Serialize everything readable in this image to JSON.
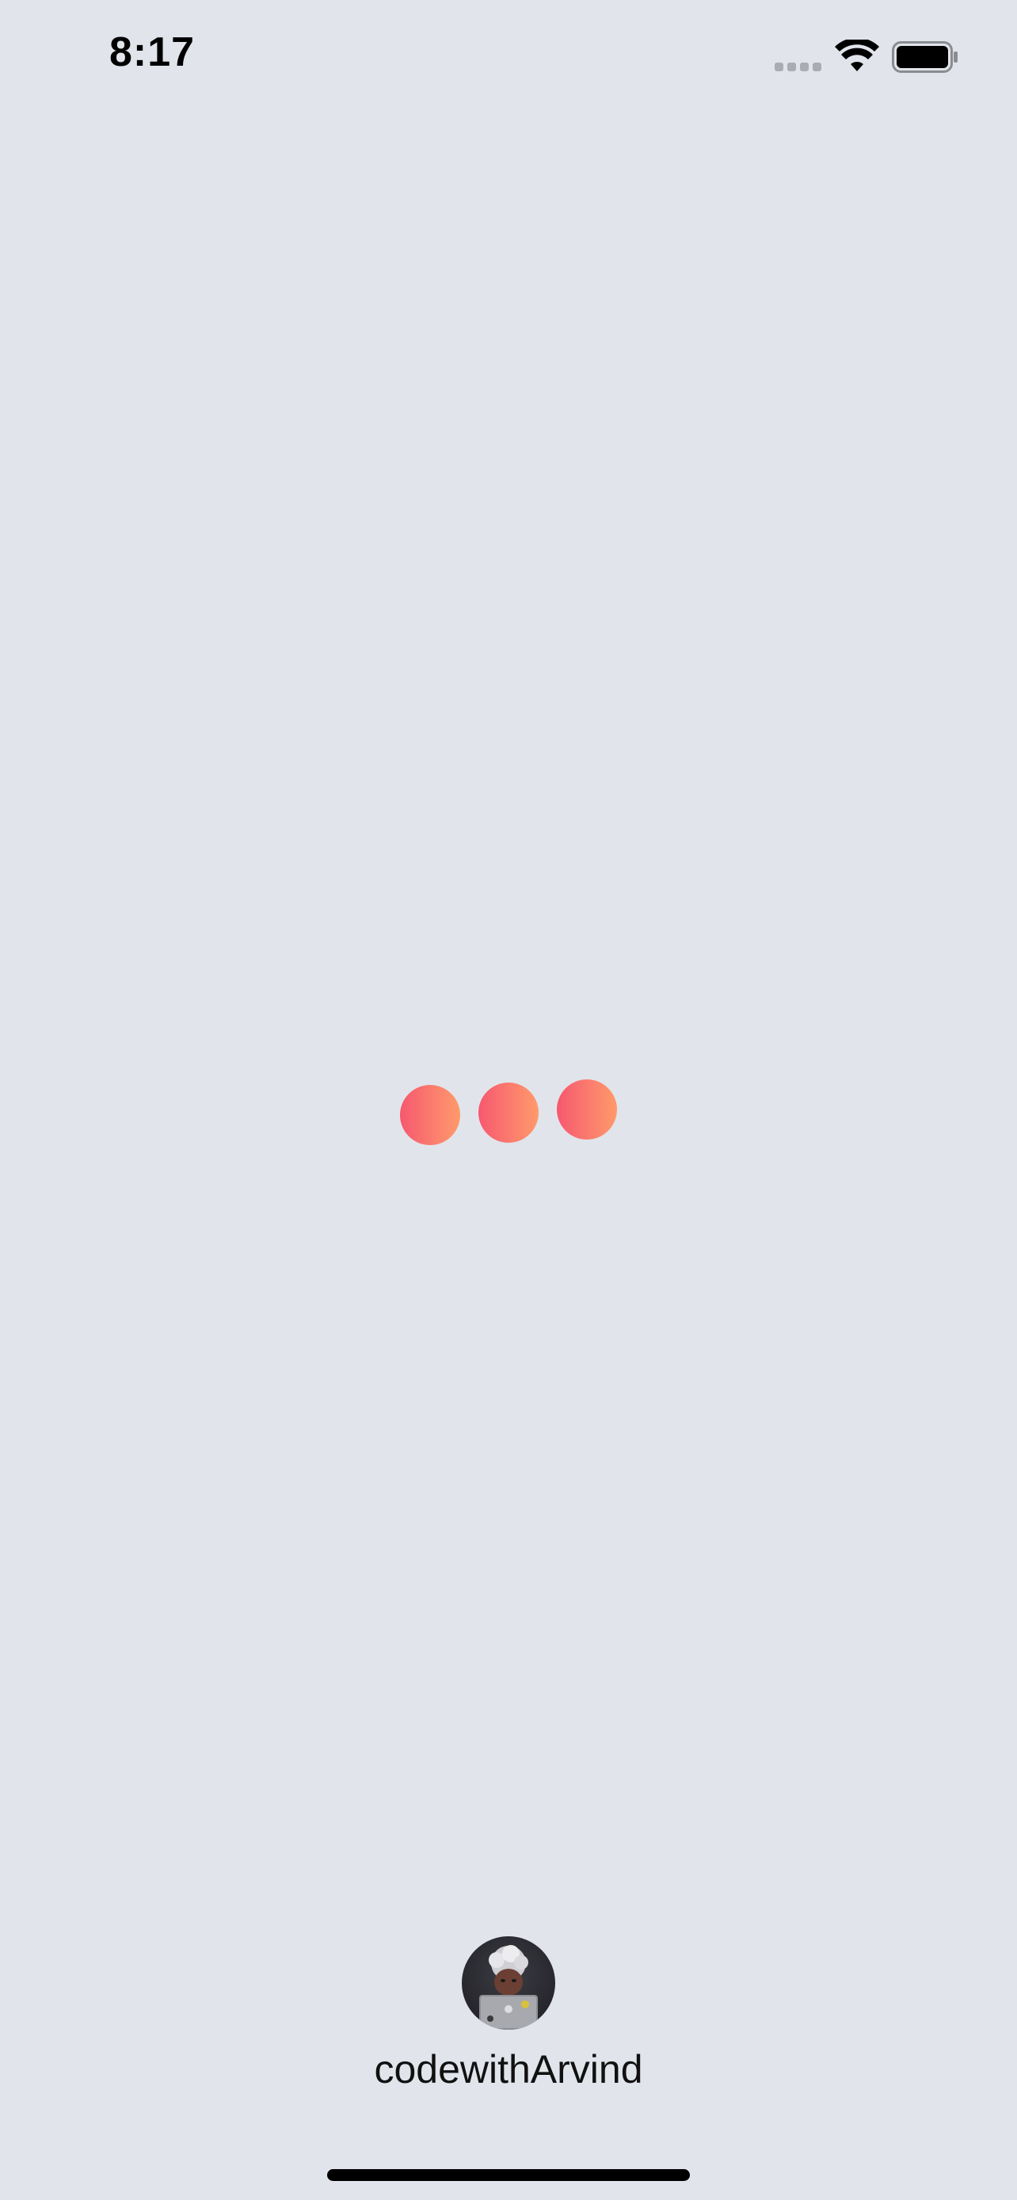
{
  "status_bar": {
    "time": "8:17",
    "signal_icon": "cellular-signal-dots-icon",
    "wifi_icon": "wifi-icon",
    "battery_icon": "battery-full-icon"
  },
  "loader": {
    "icon": "loading-dots-icon",
    "dot_count": 3,
    "gradient_colors": [
      "#f6586f",
      "#ff9a6a"
    ]
  },
  "profile": {
    "avatar_icon": "avatar-memoji-icon",
    "name": "codewithArvind"
  },
  "colors": {
    "background": "#e1e5eb",
    "text": "#111111"
  }
}
